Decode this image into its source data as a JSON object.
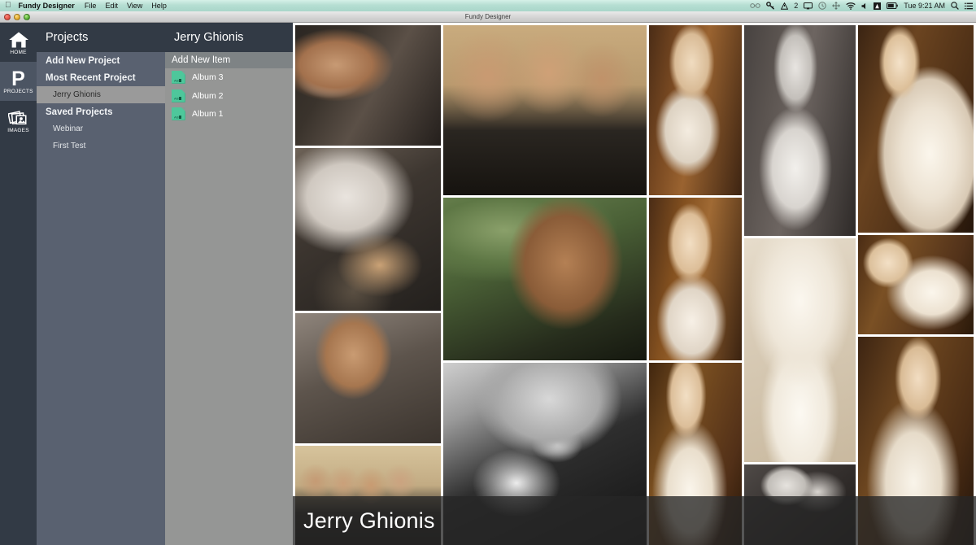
{
  "menubar": {
    "apple_icon": "apple-icon",
    "app_name": "Fundy Designer",
    "menus": [
      "File",
      "Edit",
      "View",
      "Help"
    ],
    "status": {
      "eyeglasses_icon": "eyeglasses-icon",
      "key_icon": "key-icon",
      "hazard_icon": "hazard-icon",
      "hazard_count": "2",
      "airplay_icon": "airplay-icon",
      "clock_circle_icon": "clock-circle-icon",
      "move_icon": "move-icon",
      "wifi_icon": "wifi-icon",
      "volume_icon": "volume-icon",
      "adobe_icon": "adobe-icon",
      "battery_icon": "battery-icon",
      "clock": "Tue 9:21 AM",
      "search_icon": "search-icon",
      "notification_center_icon": "notification-center-icon"
    }
  },
  "window": {
    "title": "Fundy Designer",
    "close_button": "close-button",
    "minimize_button": "minimize-button",
    "zoom_button": "zoom-button"
  },
  "rail": {
    "items": [
      {
        "label": "HOME",
        "icon": "home-icon",
        "active": false
      },
      {
        "label": "PROJECTS",
        "icon": "projects-icon",
        "active": true
      },
      {
        "label": "IMAGES",
        "icon": "images-icon",
        "active": false
      }
    ]
  },
  "projects_panel": {
    "header": "Projects",
    "add_new": "Add New Project",
    "most_recent_label": "Most Recent Project",
    "most_recent_item": "Jerry Ghionis",
    "saved_label": "Saved Projects",
    "saved_items": [
      "Webinar",
      "First Test"
    ]
  },
  "items_panel": {
    "header": "Jerry Ghionis",
    "add_new": "Add New Item",
    "albums": [
      {
        "label": "Album 3",
        "icon": "album-icon"
      },
      {
        "label": "Album 2",
        "icon": "album-icon"
      },
      {
        "label": "Album 1",
        "icon": "album-icon"
      }
    ]
  },
  "gallery": {
    "overlay_title": "Jerry Ghionis",
    "photos": [
      {
        "name": "photo-groom-white-shirt",
        "alt": "Groom in white shirt and vest smiling"
      },
      {
        "name": "photo-groom-with-drink",
        "alt": "Groom seated holding a whiskey glass"
      },
      {
        "name": "photo-groom-upside-down",
        "alt": "Inverted portrait of laughing groomsman"
      },
      {
        "name": "photo-groomsmen-stone-wall",
        "alt": "Four groomsmen laughing by a stone wall"
      },
      {
        "name": "photo-groom-green-field",
        "alt": "Groom in tuxedo against green foliage"
      },
      {
        "name": "photo-groom-bowtie-bw",
        "alt": "Black and white groom adjusting bow tie"
      },
      {
        "name": "photo-groomsmen-group",
        "alt": "Group of five groomsmen laughing"
      },
      {
        "name": "photo-bride-wood-wall",
        "alt": "Bride in gown against wood panel wall"
      },
      {
        "name": "photo-bride-smiling-wood",
        "alt": "Bride smiling against wood wall"
      },
      {
        "name": "photo-bride-strapless",
        "alt": "Bride in strapless gown smiling"
      },
      {
        "name": "photo-bride-bw-portrait",
        "alt": "Black and white bride portrait smiling"
      },
      {
        "name": "photo-dress-detail",
        "alt": "Close up of bridal gown bodice with necklace"
      },
      {
        "name": "photo-bride-bw-getting-ready",
        "alt": "Black and white bride getting ready"
      },
      {
        "name": "photo-bride-ruffled-gown",
        "alt": "Bride in ruffled ballgown"
      },
      {
        "name": "photo-bride-necklace",
        "alt": "Bride with pearl necklace and ruffles"
      },
      {
        "name": "photo-bride-veil",
        "alt": "Bride with veil and pearl necklace"
      }
    ]
  },
  "colors": {
    "rail_bg": "#323a45",
    "rail_active": "#4c5563",
    "projects_panel_bg": "#596170",
    "items_panel_bg": "#959695",
    "header_bg": "#323a45",
    "selection": "#9a9a9a",
    "album_green": "#4ec79b",
    "overlay": "rgba(38,38,38,0.78)"
  }
}
